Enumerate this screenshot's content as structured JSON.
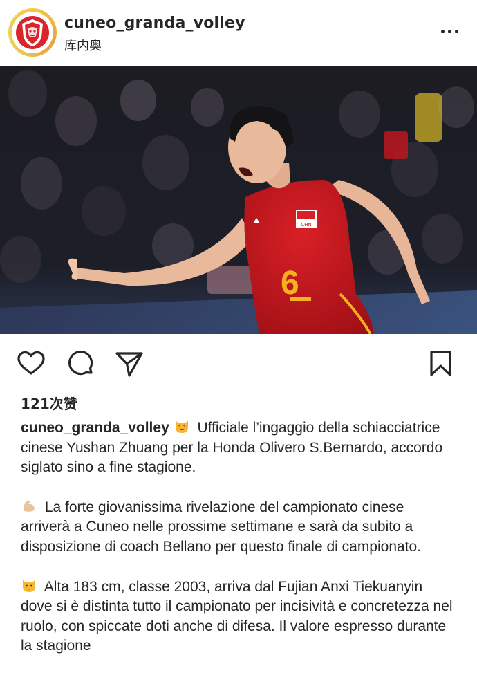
{
  "post": {
    "username": "cuneo_granda_volley",
    "location": "库内奥",
    "likes": "121次赞"
  },
  "icons": {
    "avatar": "team-logo-icon",
    "more": "more-horizontal-icon",
    "like": "heart-icon",
    "comment": "comment-icon",
    "share": "send-icon",
    "save": "bookmark-icon"
  },
  "photo": {
    "jersey_number": "6",
    "jersey_badge": "CHN"
  },
  "caption": {
    "username": "cuneo_granda_volley",
    "p1": "Ufficiale l’ingaggio della schiacciatrice cinese Yushan Zhuang per la Honda Olivero S.Bernardo, accordo siglato sino a fine stagione.",
    "p2": "La forte giovanissima rivelazione del campionato cinese arriverà a Cuneo nelle prossime settimane e sarà da subito a disposizione di coach Bellano per questo finale di campionato.",
    "p3": "Alta 183 cm, classe 2003, arriva dal Fujian Anxi Tiekuanyin dove si è distinta tutto il campionato per incisività e concretezza nel ruolo, con spiccate doti anche di difesa. Il valore espresso durante la stagione"
  },
  "colors": {
    "jersey_red": "#c8161d",
    "jersey_number": "#f5b21f",
    "text": "#262626",
    "ring": "#f7c948"
  }
}
